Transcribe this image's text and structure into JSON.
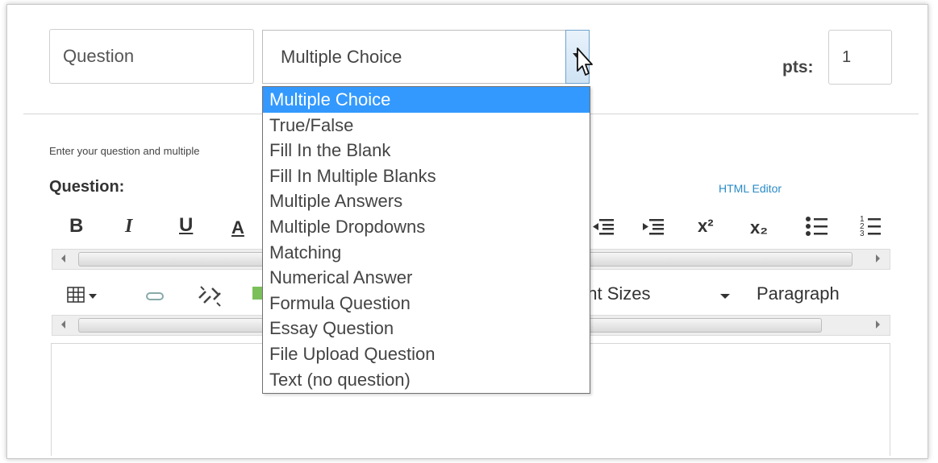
{
  "question_name": "Question",
  "question_type": {
    "selected": "Multiple Choice",
    "options": [
      "Multiple Choice",
      "True/False",
      "Fill In the Blank",
      "Fill In Multiple Blanks",
      "Multiple Answers",
      "Multiple Dropdowns",
      "Matching",
      "Numerical Answer",
      "Formula Question",
      "Essay Question",
      "File Upload Question",
      "Text (no question)"
    ]
  },
  "points": {
    "label": "pts:",
    "value": "1"
  },
  "instructions": "Enter your question and multiple",
  "question_label": "Question:",
  "html_editor_link": "HTML Editor",
  "toolbar": {
    "bold": "B",
    "italic": "I",
    "underline": "U",
    "font_color": "A",
    "superscript": "x²",
    "subscript": "x₂",
    "font_sizes": "ont Sizes",
    "paragraph": "Paragraph"
  },
  "colors": {
    "selected_option": "#3399ff",
    "link": "#2a8bc7"
  }
}
